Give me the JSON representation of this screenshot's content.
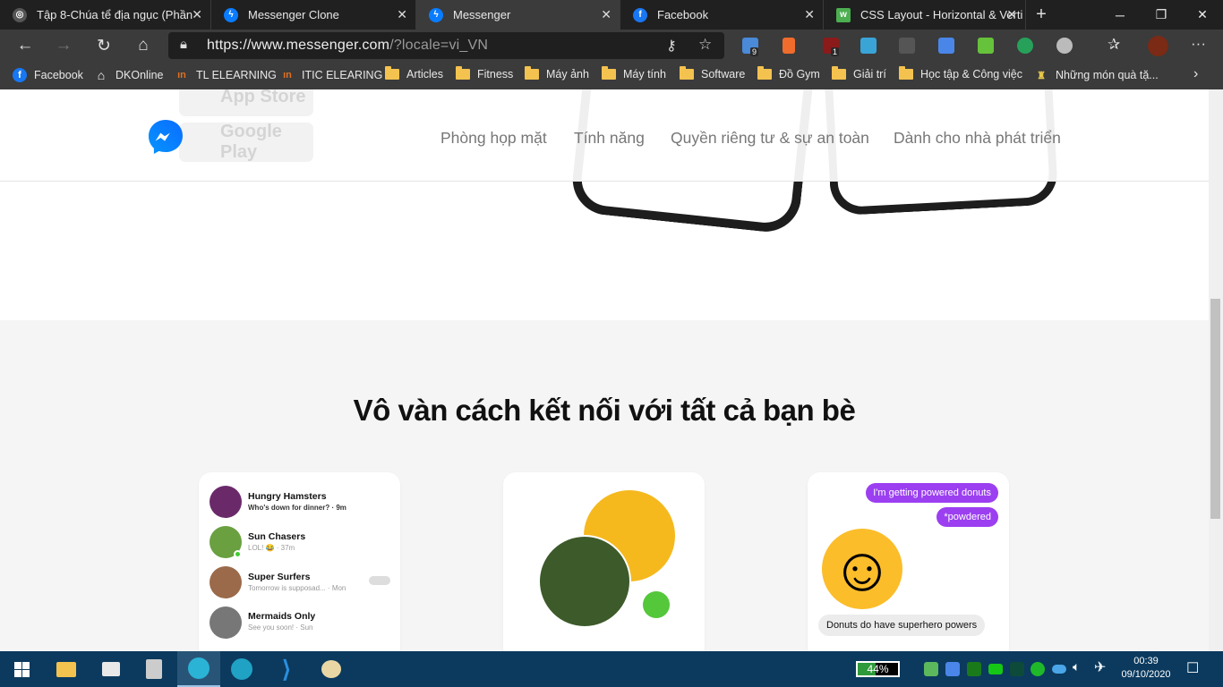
{
  "tabs": [
    {
      "title": "Tập 8-Chúa tể địa ngục (Phần",
      "icon": "hub-icon"
    },
    {
      "title": "Messenger Clone",
      "icon": "messenger-icon"
    },
    {
      "title": "Messenger",
      "icon": "messenger-icon"
    },
    {
      "title": "Facebook",
      "icon": "facebook-icon"
    },
    {
      "title": "CSS Layout - Horizontal & Verti",
      "icon": "w3schools-icon"
    }
  ],
  "address": {
    "url_main": "https://www.messenger.com",
    "url_rest": "/?locale=vi_VN"
  },
  "extension_badges": {
    "mail": "9",
    "ublock": "1"
  },
  "bookmarks": [
    {
      "label": "Facebook",
      "icon": "facebook-icon"
    },
    {
      "label": "DKOnline",
      "icon": "house-icon"
    },
    {
      "label": "TL ELEARNING",
      "icon": "elearning-icon"
    },
    {
      "label": "ITIC ELEARING",
      "icon": "elearning-icon"
    },
    {
      "label": "Articles",
      "icon": "folder-icon"
    },
    {
      "label": "Fitness",
      "icon": "folder-icon"
    },
    {
      "label": "Máy ảnh",
      "icon": "folder-icon"
    },
    {
      "label": "Máy tính",
      "icon": "folder-icon"
    },
    {
      "label": "Software",
      "icon": "folder-icon"
    },
    {
      "label": "Đồ Gym",
      "icon": "folder-icon"
    },
    {
      "label": "Giải trí",
      "icon": "folder-icon"
    },
    {
      "label": "Học tập & Công việc",
      "icon": "folder-icon"
    },
    {
      "label": "Những món quà tặ...",
      "icon": "gift-icon"
    }
  ],
  "page": {
    "nav": [
      "Phòng họp mặt",
      "Tính năng",
      "Quyền riêng tư & sự an toàn",
      "Dành cho nhà phát triển"
    ],
    "store_badges": [
      "App Store",
      "Google Play"
    ],
    "heading": "Vô vàn cách kết nối với tất cả bạn bè",
    "chats": [
      {
        "name": "Hungry Hamsters",
        "sub": "Who's down for dinner? · 9m"
      },
      {
        "name": "Sun Chasers",
        "sub": "LOL! 😂 · 37m"
      },
      {
        "name": "Super Surfers",
        "sub": "Tomorrow is supposad... · Mon"
      },
      {
        "name": "Mermaids Only",
        "sub": "See you soon! · Sun"
      }
    ],
    "bubbles": [
      "I'm getting powered donuts",
      "*powdered"
    ],
    "reply": "Donuts do have superhero powers"
  },
  "taskbar": {
    "battery": "44%",
    "time": "00:39",
    "date": "09/10/2020"
  },
  "colors": {
    "messenger_blue": "#0a7cff",
    "bubble_purple": "#9b3ff1",
    "taskbar": "#0b3a5e"
  }
}
